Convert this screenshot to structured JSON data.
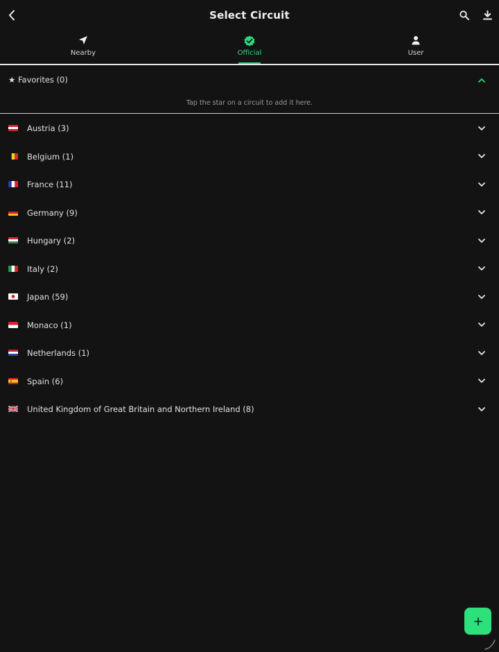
{
  "header": {
    "title": "Select Circuit",
    "icons": {
      "back": "chevron-left-icon",
      "search": "search-icon",
      "download": "download-icon"
    }
  },
  "tabs": [
    {
      "id": "nearby",
      "label": "Nearby",
      "icon": "navigation-arrow-icon",
      "active": false
    },
    {
      "id": "official",
      "label": "Official",
      "icon": "verified-check-icon",
      "active": true
    },
    {
      "id": "user",
      "label": "User",
      "icon": "person-icon",
      "active": false
    }
  ],
  "favorites": {
    "label": "★ Favorites (0)",
    "hint": "Tap the star on a circuit to add it here.",
    "expanded": true
  },
  "countries": [
    {
      "label": "Austria (3)",
      "flag": "austria-flag-icon"
    },
    {
      "label": "Belgium (1)",
      "flag": "belgium-flag-icon"
    },
    {
      "label": "France (11)",
      "flag": "france-flag-icon"
    },
    {
      "label": "Germany (9)",
      "flag": "germany-flag-icon"
    },
    {
      "label": "Hungary (2)",
      "flag": "hungary-flag-icon"
    },
    {
      "label": "Italy (2)",
      "flag": "italy-flag-icon"
    },
    {
      "label": "Japan (59)",
      "flag": "japan-flag-icon"
    },
    {
      "label": "Monaco (1)",
      "flag": "monaco-flag-icon"
    },
    {
      "label": "Netherlands (1)",
      "flag": "netherlands-flag-icon"
    },
    {
      "label": "Spain (6)",
      "flag": "spain-flag-icon"
    },
    {
      "label": "United Kingdom of Great Britain and Northern Ireland (8)",
      "flag": "uk-flag-icon"
    }
  ],
  "fab": {
    "icon": "plus-icon"
  },
  "colors": {
    "background": "#131313",
    "accent": "#2ed87a",
    "text": "#e2e2e2",
    "hint": "#9a9a9a"
  }
}
